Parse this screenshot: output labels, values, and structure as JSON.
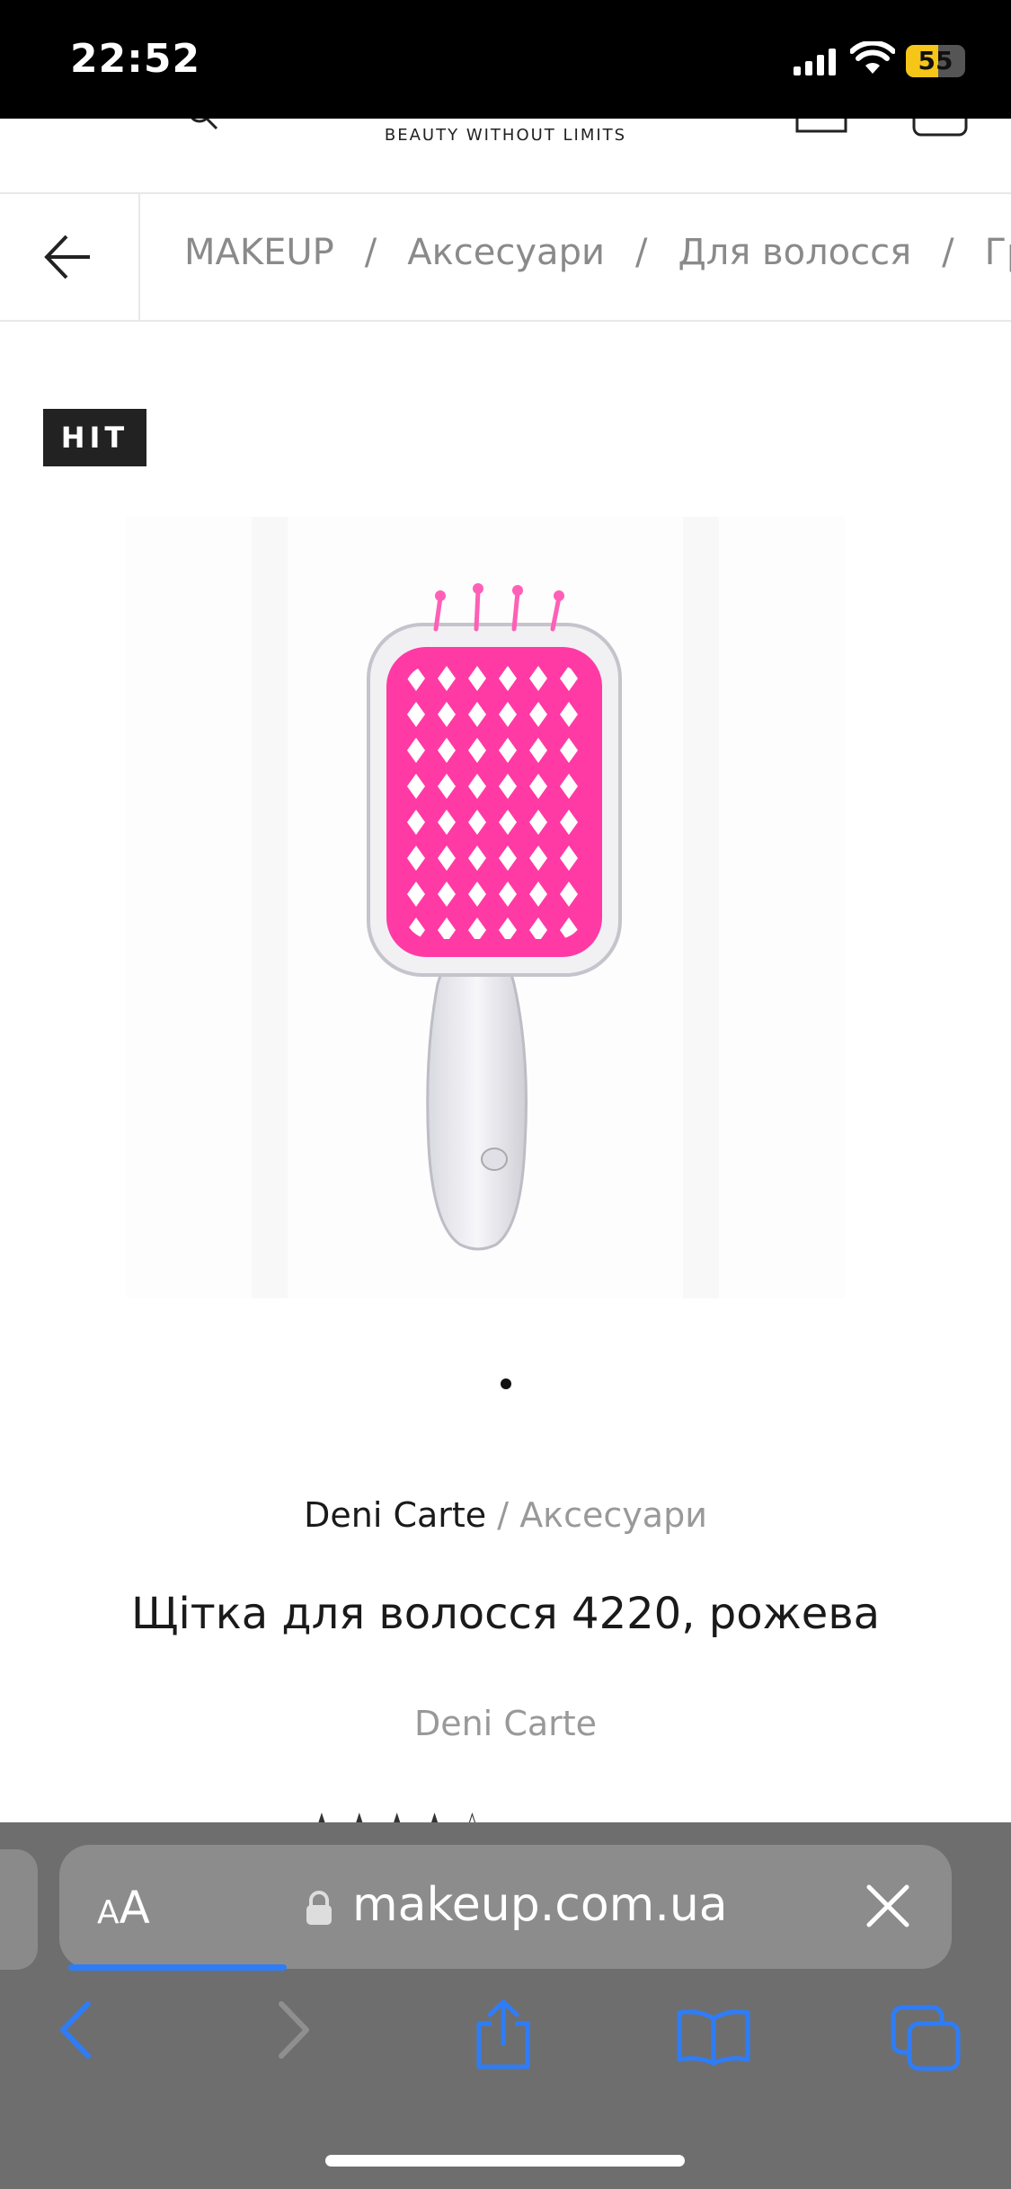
{
  "status_bar": {
    "time": "22:52",
    "battery": "55",
    "battery_level": 0.55
  },
  "header": {
    "tagline": "BEAUTY WITHOUT LIMITS",
    "icons": [
      "search-icon",
      "account-icon",
      "cart-icon"
    ]
  },
  "breadcrumb": {
    "back_icon": "arrow-left-icon",
    "items": [
      "MAKEUP",
      "Аксесуари",
      "Для волосся",
      "Гр"
    ],
    "separator": "/"
  },
  "badge": "HIT",
  "product": {
    "image_alt": "pink hair brush",
    "gallery_page": 1,
    "brand": "Deni Carte",
    "brand_separator": "/",
    "category": "Аксесуари",
    "title": "Щітка для волосся 4220, рожева",
    "brand_sub": "Deni Carte",
    "rating_stars": 4
  },
  "safari": {
    "aa_label_small": "A",
    "aa_label_large": "A",
    "url": "makeup.com.ua",
    "load_progress": 0.25,
    "toolbar": [
      "back-icon",
      "forward-icon",
      "share-icon",
      "bookmarks-icon",
      "tabs-icon"
    ]
  },
  "colors": {
    "accent_pink": "#ff3aa5",
    "badge_bg": "#222222",
    "safari_blue": "#2f7df6",
    "safari_bg": "#6e6e6e"
  }
}
